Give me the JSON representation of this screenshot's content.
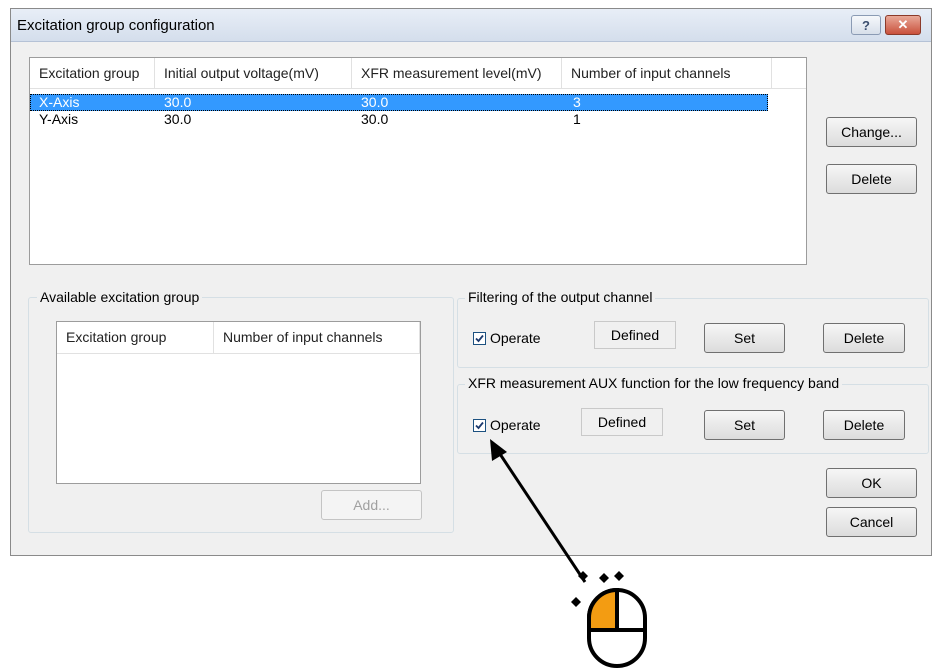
{
  "window": {
    "title": "Excitation group configuration",
    "help_label": "?",
    "close_label": "✕"
  },
  "groups_table": {
    "columns": [
      "Excitation group",
      "Initial output voltage(mV)",
      "XFR measurement level(mV)",
      "Number of input channels"
    ],
    "rows": [
      {
        "group": "X-Axis",
        "voltage": "30.0",
        "level": "30.0",
        "channels": "3"
      },
      {
        "group": "Y-Axis",
        "voltage": "30.0",
        "level": "30.0",
        "channels": "1"
      }
    ]
  },
  "side_buttons": {
    "change": "Change...",
    "delete": "Delete"
  },
  "available": {
    "title": "Available excitation group",
    "columns": [
      "Excitation group",
      "Number of input channels"
    ],
    "add_label": "Add..."
  },
  "filtering": {
    "title": "Filtering of the output channel",
    "operate_label": "Operate",
    "operate_checked": true,
    "status": "Defined",
    "set_label": "Set",
    "delete_label": "Delete"
  },
  "xfr_aux": {
    "title": "XFR measurement AUX function for the low frequency band",
    "operate_label": "Operate",
    "operate_checked": true,
    "status": "Defined",
    "set_label": "Set",
    "delete_label": "Delete"
  },
  "dialog_buttons": {
    "ok": "OK",
    "cancel": "Cancel"
  },
  "annotation": {
    "icon": "mouse-click-icon",
    "accent_color": "#f39c12"
  }
}
